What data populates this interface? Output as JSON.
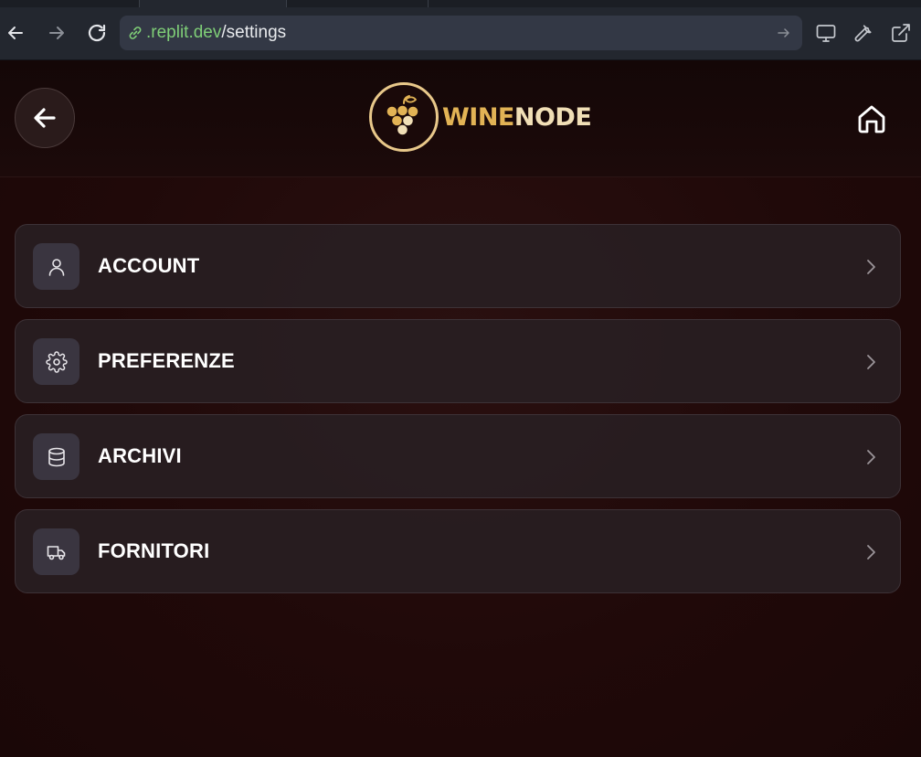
{
  "browser": {
    "url_domain": ".replit.dev",
    "url_path": "/settings"
  },
  "app": {
    "logo": {
      "wine": "WINE",
      "node": "NODE"
    },
    "menu": [
      {
        "label": "ACCOUNT",
        "icon": "user-icon"
      },
      {
        "label": "PREFERENZE",
        "icon": "gear-icon"
      },
      {
        "label": "ARCHIVI",
        "icon": "database-icon"
      },
      {
        "label": "FORNITORI",
        "icon": "truck-icon"
      }
    ]
  },
  "colors": {
    "background": "#1a0808",
    "card": "#281e22",
    "logo_gold": "#e2b355",
    "logo_cream": "#f1dfb6",
    "url_domain": "#7fce77"
  }
}
